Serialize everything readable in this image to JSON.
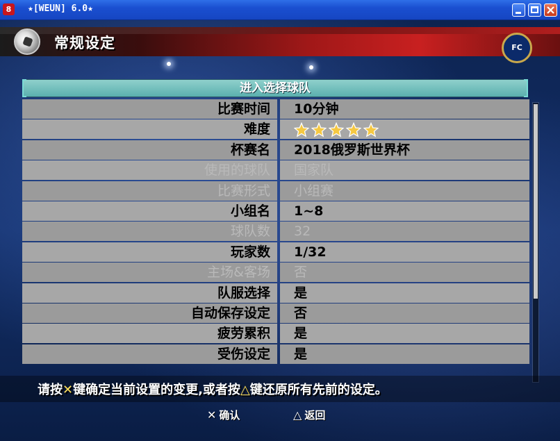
{
  "window": {
    "title": "★[WEUN] 6.0★",
    "app_icon_glyph": "8"
  },
  "header": {
    "title": "常规设定",
    "club_badge_text": "FC"
  },
  "panel": {
    "header_label": "进入选择球队",
    "rows": [
      {
        "label": "比赛时间",
        "value": "10分钟",
        "disabled": false
      },
      {
        "label": "难度",
        "value": "",
        "stars": 5,
        "disabled": false
      },
      {
        "label": "杯赛名",
        "value": "2018俄罗斯世界杯",
        "disabled": false
      },
      {
        "label": "使用的球队",
        "value": "国家队",
        "disabled": true
      },
      {
        "label": "比赛形式",
        "value": "小组赛",
        "disabled": true
      },
      {
        "label": "小组名",
        "value": "1~8",
        "disabled": false
      },
      {
        "label": "球队数",
        "value": "32",
        "disabled": true
      },
      {
        "label": "玩家数",
        "value": "1/32",
        "disabled": false
      },
      {
        "label": "主场&客场",
        "value": "否",
        "disabled": true
      },
      {
        "label": "队服选择",
        "value": "是",
        "disabled": false
      },
      {
        "label": "自动保存设定",
        "value": "否",
        "disabled": false
      },
      {
        "label": "疲劳累积",
        "value": "是",
        "disabled": false
      },
      {
        "label": "受伤设定",
        "value": "是",
        "disabled": false
      }
    ]
  },
  "hint": {
    "part1": "请按",
    "cross_symbol": "✕",
    "part2": "键确定当前设置的变更,或者按",
    "triangle_symbol": "△",
    "part3": "键还原所有先前的设定。"
  },
  "footer": {
    "confirm_symbol": "✕",
    "confirm_label": "确认",
    "back_symbol": "△",
    "back_label": "返回"
  },
  "colors": {
    "row_bg": "#9b9b9b",
    "header_teal": "#5bb0ae",
    "star_gold": "#f5c842",
    "banner_red": "#c82020"
  }
}
